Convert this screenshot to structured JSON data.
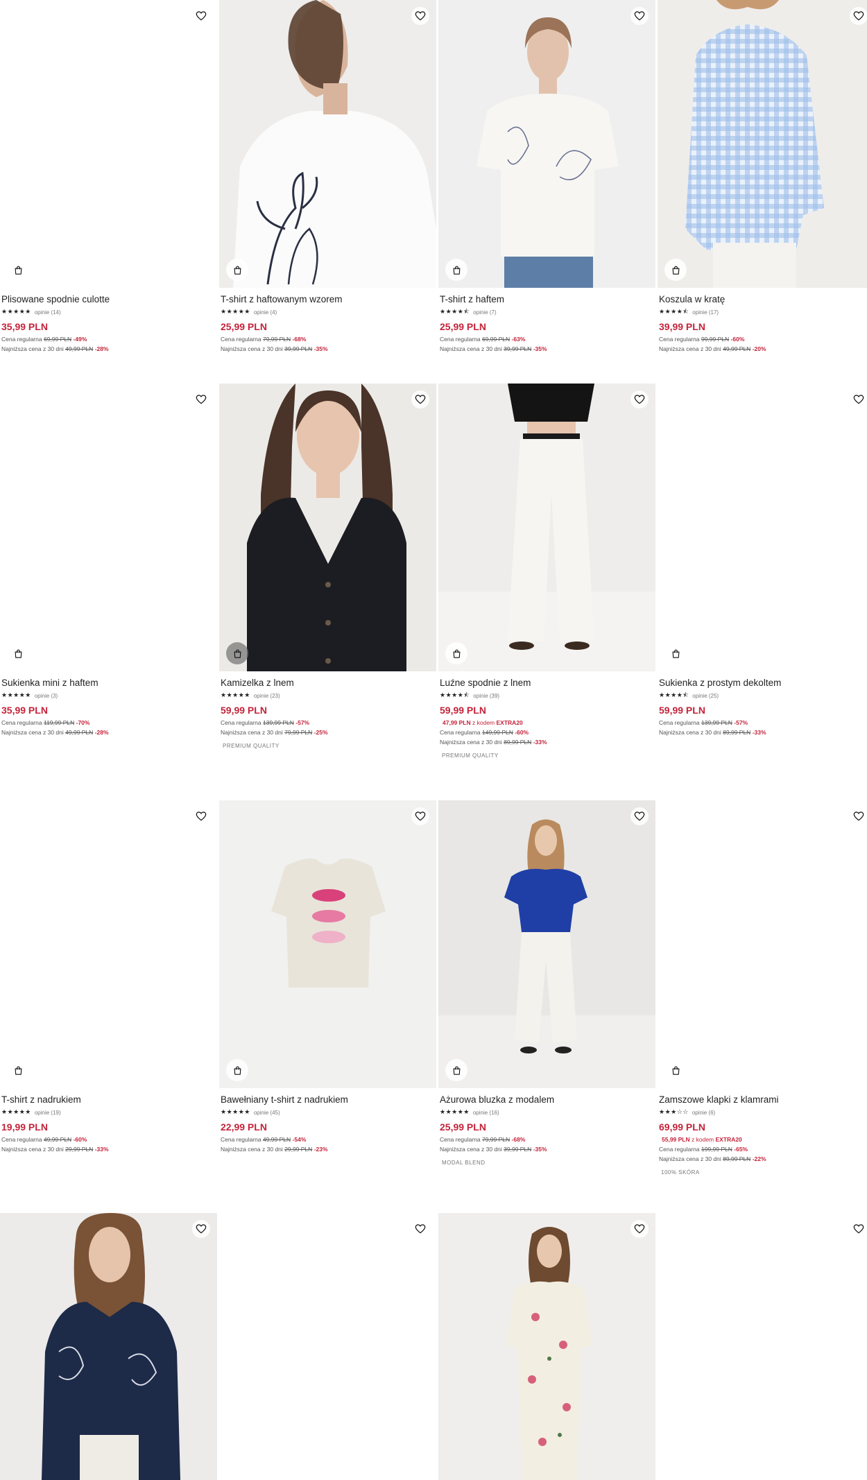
{
  "products": [
    {
      "name": "Plisowane spodnie culotte",
      "reviews": "opinie (14)",
      "price": "35,99 PLN",
      "regular_label": "Cena regularna",
      "regular_price": "69,99 PLN",
      "regular_disc": "-49%",
      "lowest_label": "Najniższa cena z 30 dni",
      "lowest_price": "49,99 PLN",
      "lowest_disc": "-28%"
    },
    {
      "name": "T-shirt z haftowanym wzorem",
      "reviews": "opinie (4)",
      "price": "25,99 PLN",
      "regular_label": "Cena regularna",
      "regular_price": "79,99 PLN",
      "regular_disc": "-68%",
      "lowest_label": "Najniższa cena z 30 dni",
      "lowest_price": "39,99 PLN",
      "lowest_disc": "-35%"
    },
    {
      "name": "T-shirt z haftem",
      "reviews": "opinie (7)",
      "price": "25,99 PLN",
      "regular_label": "Cena regularna",
      "regular_price": "69,99 PLN",
      "regular_disc": "-63%",
      "lowest_label": "Najniższa cena z 30 dni",
      "lowest_price": "39,99 PLN",
      "lowest_disc": "-35%"
    },
    {
      "name": "Koszula w kratę",
      "reviews": "opinie (17)",
      "price": "39,99 PLN",
      "regular_label": "Cena regularna",
      "regular_price": "99,99 PLN",
      "regular_disc": "-60%",
      "lowest_label": "Najniższa cena z 30 dni",
      "lowest_price": "49,99 PLN",
      "lowest_disc": "-20%"
    },
    {
      "name": "Sukienka mini z haftem",
      "reviews": "opinie (3)",
      "price": "35,99 PLN",
      "regular_label": "Cena regularna",
      "regular_price": "119,99 PLN",
      "regular_disc": "-70%",
      "lowest_label": "Najniższa cena z 30 dni",
      "lowest_price": "49,99 PLN",
      "lowest_disc": "-28%"
    },
    {
      "name": "Kamizelka z lnem",
      "reviews": "opinie (23)",
      "price": "59,99 PLN",
      "regular_label": "Cena regularna",
      "regular_price": "139,99 PLN",
      "regular_disc": "-57%",
      "lowest_label": "Najniższa cena z 30 dni",
      "lowest_price": "79,99 PLN",
      "lowest_disc": "-25%",
      "tag": "PREMIUM QUALITY"
    },
    {
      "name": "Luźne spodnie z lnem",
      "reviews": "opinie (39)",
      "price": "59,99 PLN",
      "promo_price": "47,99 PLN",
      "promo_label": "z kodem",
      "promo_code": "EXTRA20",
      "regular_label": "Cena regularna",
      "regular_price": "149,99 PLN",
      "regular_disc": "-60%",
      "lowest_label": "Najniższa cena z 30 dni",
      "lowest_price": "89,99 PLN",
      "lowest_disc": "-33%",
      "tag": "PREMIUM QUALITY"
    },
    {
      "name": "Sukienka z prostym dekoltem",
      "reviews": "opinie (25)",
      "price": "59,99 PLN",
      "regular_label": "Cena regularna",
      "regular_price": "139,99 PLN",
      "regular_disc": "-57%",
      "lowest_label": "Najniższa cena z 30 dni",
      "lowest_price": "89,99 PLN",
      "lowest_disc": "-33%"
    },
    {
      "name": "T-shirt z nadrukiem",
      "reviews": "opinie (19)",
      "price": "19,99 PLN",
      "regular_label": "Cena regularna",
      "regular_price": "49,99 PLN",
      "regular_disc": "-60%",
      "lowest_label": "Najniższa cena z 30 dni",
      "lowest_price": "29,99 PLN",
      "lowest_disc": "-33%"
    },
    {
      "name": "Bawełniany t-shirt z nadrukiem",
      "reviews": "opinie (45)",
      "price": "22,99 PLN",
      "regular_label": "Cena regularna",
      "regular_price": "49,99 PLN",
      "regular_disc": "-54%",
      "lowest_label": "Najniższa cena z 30 dni",
      "lowest_price": "29,99 PLN",
      "lowest_disc": "-23%"
    },
    {
      "name": "Ażurowa bluzka z modalem",
      "reviews": "opinie (16)",
      "price": "25,99 PLN",
      "regular_label": "Cena regularna",
      "regular_price": "79,99 PLN",
      "regular_disc": "-68%",
      "lowest_label": "Najniższa cena z 30 dni",
      "lowest_price": "39,99 PLN",
      "lowest_disc": "-35%",
      "tag": "MODAL BLEND"
    },
    {
      "name": "Zamszowe klapki z klamrami",
      "reviews": "opinie (6)",
      "price": "69,99 PLN",
      "promo_price": "55,99 PLN",
      "promo_label": "z kodem",
      "promo_code": "EXTRA20",
      "regular_label": "Cena regularna",
      "regular_price": "199,99 PLN",
      "regular_disc": "-65%",
      "lowest_label": "Najniższa cena z 30 dni",
      "lowest_price": "89,99 PLN",
      "lowest_disc": "-22%",
      "tag": "100% SKÓRA"
    }
  ],
  "stars": [
    "★★★★★",
    "★★★★★",
    "★★★★⯪",
    "★★★★⯪",
    "★★★★★",
    "★★★★★",
    "★★★★⯪",
    "★★★★⯪",
    "★★★★★",
    "★★★★★",
    "★★★★★",
    "★★★☆☆"
  ],
  "colors": {
    "accent": "#c4233a",
    "text": "#222222",
    "muted": "#777777"
  },
  "icons": {
    "wishlist": "heart-icon",
    "cart": "shopping-bag-icon"
  }
}
